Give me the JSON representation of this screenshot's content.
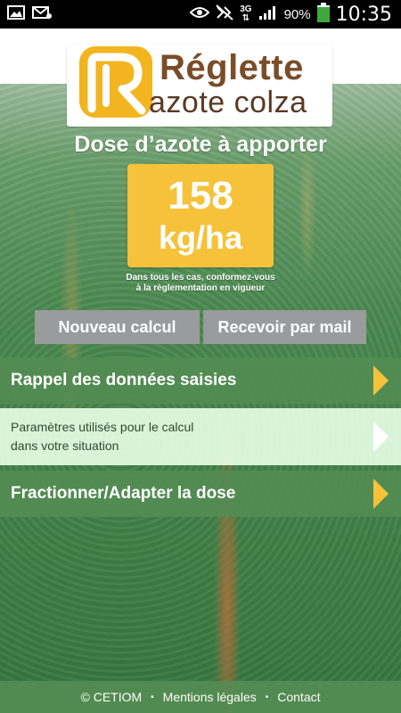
{
  "status_bar": {
    "icons": [
      "gallery-icon",
      "email-icon",
      "eye-icon",
      "mute-icon",
      "network-3g-icon",
      "signal-icon",
      "battery-icon"
    ],
    "network": "3G",
    "battery": "90%",
    "time": "10:35"
  },
  "logo": {
    "line1": "Réglette",
    "line2": "azote colza",
    "colors": {
      "mark": "#f2b51f",
      "text": "#7a4d28"
    }
  },
  "result": {
    "title": "Dose d’azote à apporter",
    "value": "158",
    "unit": "kg/ha",
    "notice_line1": "Dans tous les cas, conformez-vous",
    "notice_line2": "à la règlementation en vigueur"
  },
  "buttons": {
    "new_calc": "Nouveau calcul",
    "send_mail": "Recevoir par mail"
  },
  "rows": {
    "rappel": "Rappel des données saisies",
    "params_line1": "Paramètres utilisés pour le calcul",
    "params_line2": "dans votre situation",
    "fractionner": "Fractionner/Adapter la dose"
  },
  "footer": {
    "copyright": "© CETIOM",
    "separator": "•",
    "legal": "Mentions légales",
    "contact": "Contact"
  },
  "colors": {
    "accent_yellow": "#f5c23a",
    "row_green": "#548c54",
    "button_grey": "#9a9b9c"
  }
}
